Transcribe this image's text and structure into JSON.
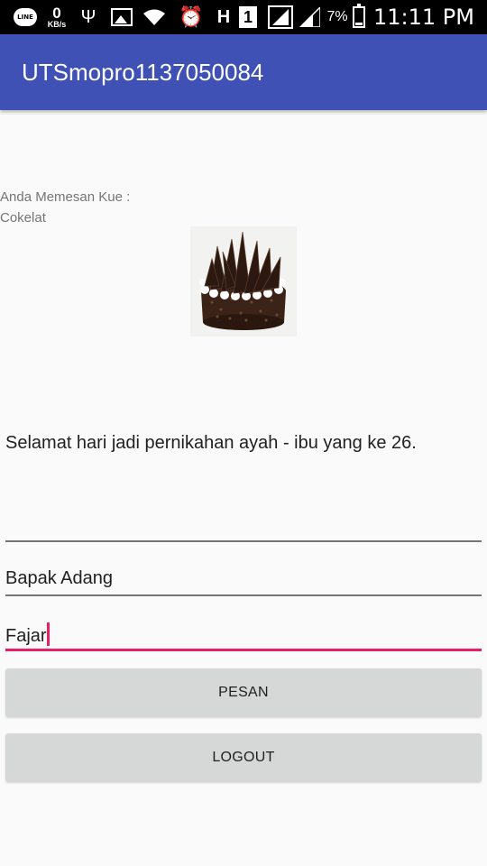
{
  "status_bar": {
    "line_icon": "line-app-icon",
    "speed_value": "0",
    "speed_unit": "KB/s",
    "battery_percent": "7%",
    "time": "11:11 PM",
    "network_type": "H",
    "sim_label": "1"
  },
  "app_bar": {
    "title": "UTSmopro1137050084",
    "color": "#3f51b5"
  },
  "order": {
    "label_line1": "Anda Memesan Kue :",
    "label_line2": "Cokelat",
    "image_icon": "chocolate-cake-image"
  },
  "message": "Selamat hari jadi pernikahan ayah - ibu yang ke 26.",
  "fields": {
    "empty_value": "",
    "recipient_value": "Bapak Adang",
    "sender_value": "Fajar"
  },
  "buttons": {
    "pesan": "PESAN",
    "logout": "LOGOUT"
  },
  "colors": {
    "accent": "#e91e63",
    "button_bg": "#d6d7d7"
  }
}
